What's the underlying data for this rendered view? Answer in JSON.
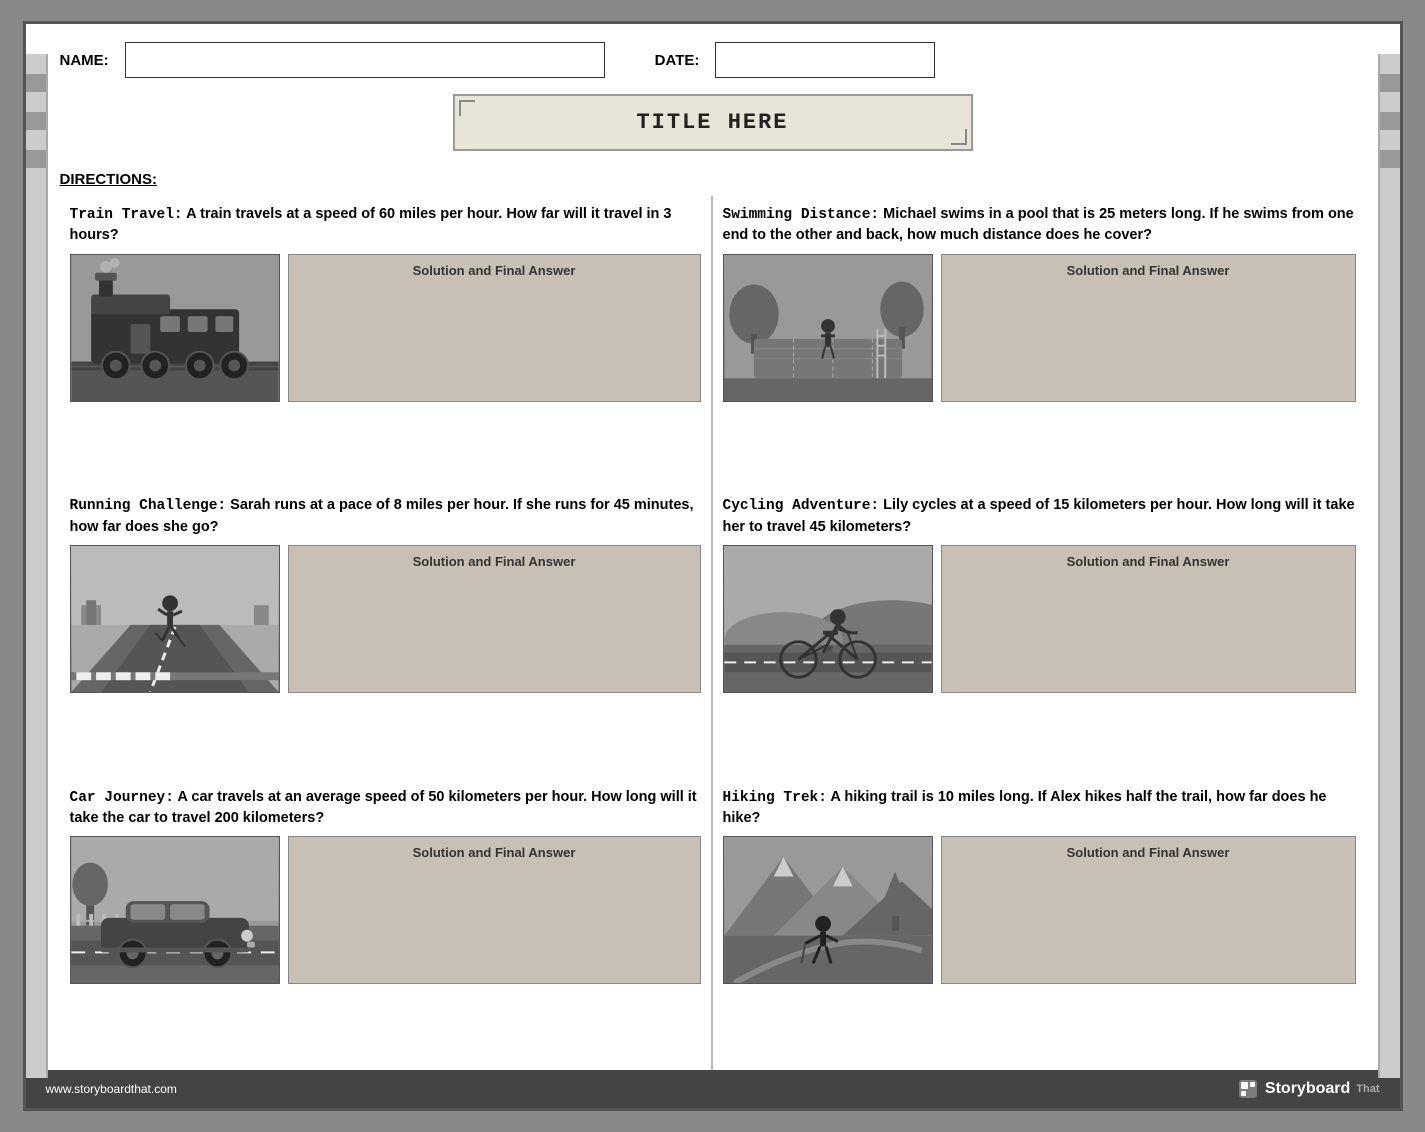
{
  "header": {
    "name_label": "NAME:",
    "date_label": "DATE:"
  },
  "title": {
    "text": "TITLE HERE"
  },
  "directions": {
    "label": "DIRECTIONS:"
  },
  "problems": [
    {
      "id": "train",
      "bold_title": "Train Travel:",
      "text": " A train travels at a speed of 60 miles per hour. How far will it travel in 3 hours?",
      "solution_label": "Solution and Final Answer",
      "scene": "train"
    },
    {
      "id": "swimming",
      "bold_title": "Swimming Distance:",
      "text": " Michael swims in a pool that is 25 meters long. If he swims from one end to the other and back, how much distance does he cover?",
      "solution_label": "Solution and Final Answer",
      "scene": "pool"
    },
    {
      "id": "running",
      "bold_title": "Running Challenge:",
      "text": " Sarah runs at a pace of 8 miles per hour. If she runs for 45 minutes, how far does she go?",
      "solution_label": "Solution and Final Answer",
      "scene": "road"
    },
    {
      "id": "cycling",
      "bold_title": "Cycling Adventure:",
      "text": " Lily cycles at a speed of 15 kilometers per hour. How long will it take her to travel 45 kilometers?",
      "solution_label": "Solution and Final Answer",
      "scene": "bike"
    },
    {
      "id": "car",
      "bold_title": "Car Journey:",
      "text": " A car travels at an average speed of 50 kilometers per hour. How long will it take the car to travel 200 kilometers?",
      "solution_label": "Solution and Final Answer",
      "scene": "car"
    },
    {
      "id": "hiking",
      "bold_title": "Hiking Trek:",
      "text": " A hiking trail is 10 miles long. If Alex hikes half the trail, how far does he hike?",
      "solution_label": "Solution and Final Answer",
      "scene": "hike"
    }
  ],
  "footer": {
    "url": "www.storyboardthat.com",
    "logo_text": "Storyboard"
  }
}
